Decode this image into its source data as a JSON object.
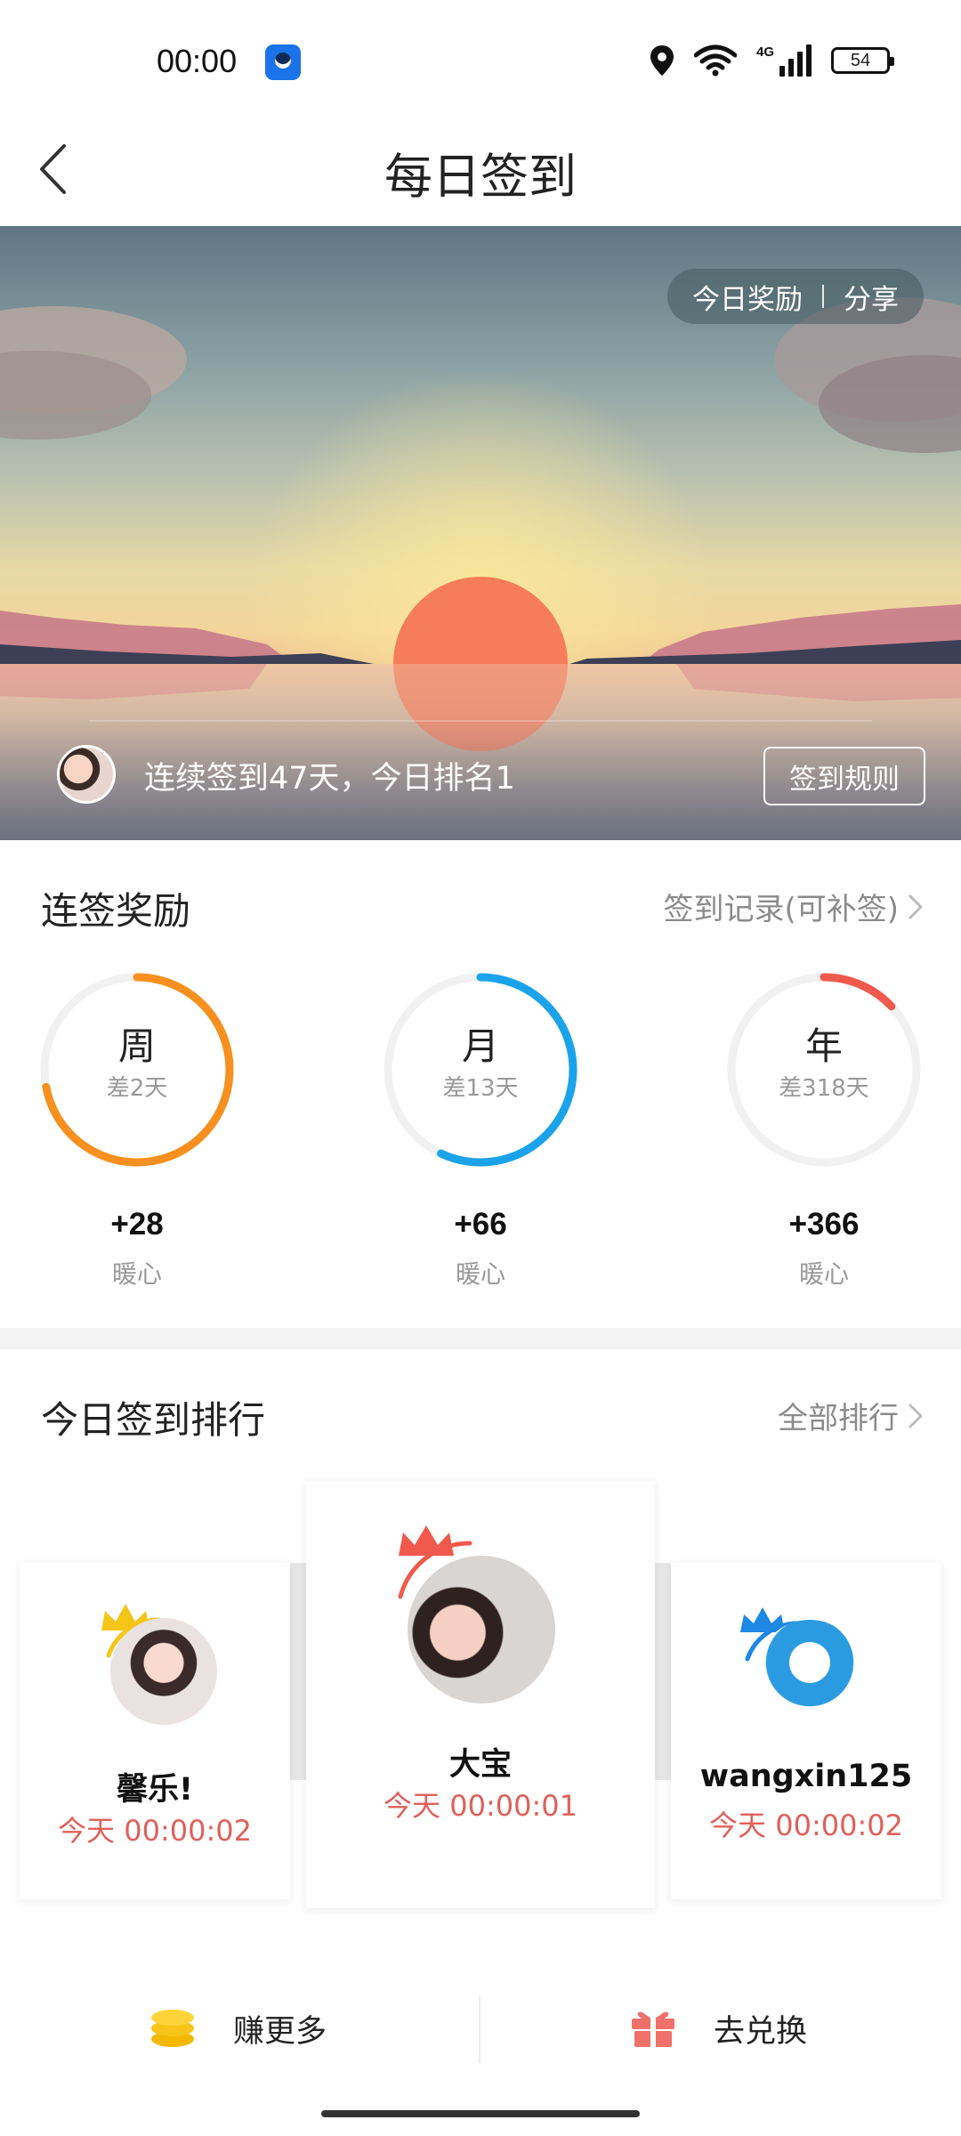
{
  "status_bar": {
    "time": "00:00",
    "network_type": "4G",
    "battery": "54"
  },
  "header": {
    "title": "每日签到"
  },
  "hero": {
    "reward_label": "今日奖励",
    "share_label": "分享",
    "streak_text": "连续签到47天，今日排名1",
    "rules_button": "签到规则"
  },
  "rewards": {
    "title": "连签奖励",
    "record_link": "签到记录(可补签)",
    "items": [
      {
        "name": "周",
        "gap": "差2天",
        "amount": "+28",
        "unit": "暖心",
        "color": "#f7901e",
        "progress": 0.72
      },
      {
        "name": "月",
        "gap": "差13天",
        "amount": "+66",
        "unit": "暖心",
        "color": "#1aa3ea",
        "progress": 0.57
      },
      {
        "name": "年",
        "gap": "差318天",
        "amount": "+366",
        "unit": "暖心",
        "color": "#f0594c",
        "progress": 0.13
      }
    ]
  },
  "ranking": {
    "title": "今日签到排行",
    "all_link": "全部排行",
    "entries": [
      {
        "rank": 2,
        "name": "馨乐!",
        "time": "今天 00:00:02",
        "crown_color": "#f5c518"
      },
      {
        "rank": 1,
        "name": "大宝",
        "time": "今天 00:00:01",
        "crown_color": "#f0594c"
      },
      {
        "rank": 3,
        "name": "wangxin125",
        "time": "今天 00:00:02",
        "crown_color": "#1e88e5"
      }
    ]
  },
  "bottom_bar": {
    "earn_more": "赚更多",
    "redeem": "去兑换"
  }
}
